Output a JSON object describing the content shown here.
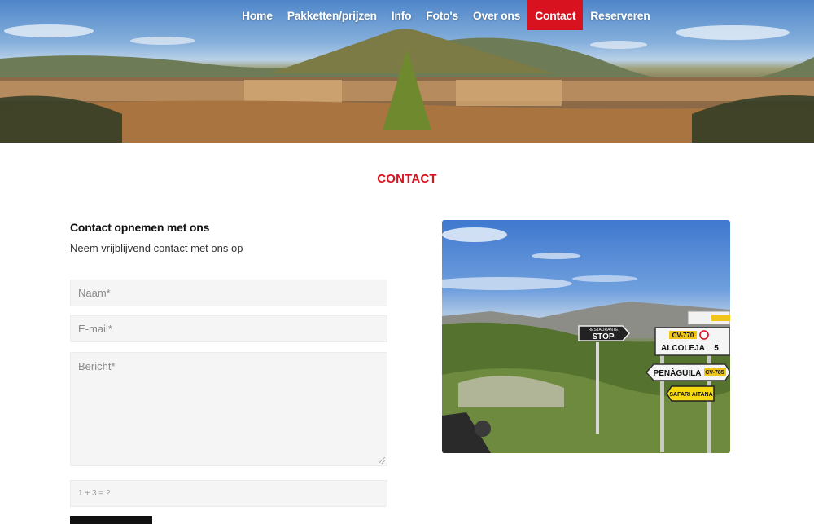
{
  "nav": {
    "items": [
      {
        "label": "Home",
        "active": false
      },
      {
        "label": "Pakketten/prijzen",
        "active": false
      },
      {
        "label": "Info",
        "active": false
      },
      {
        "label": "Foto's",
        "active": false
      },
      {
        "label": "Over ons",
        "active": false
      },
      {
        "label": "Contact",
        "active": true
      },
      {
        "label": "Reserveren",
        "active": false
      }
    ],
    "active_color": "#d9121f"
  },
  "page": {
    "title": "CONTACT",
    "accent_color": "#d9121f"
  },
  "contact": {
    "heading": "Contact opnemen met ons",
    "subtext": "Neem vrijblijvend contact met ons op"
  },
  "form": {
    "name_placeholder": "Naam*",
    "email_placeholder": "E-mail*",
    "message_placeholder": "Bericht*",
    "captcha_placeholder": "1 + 3 = ?"
  },
  "photo": {
    "signs": {
      "restaurant": "RESTAURANTE",
      "stop": "STOP",
      "road1": "CV-770",
      "town1": "ALCOLEJA",
      "town1_distance": "5",
      "town2": "PENÀGUILA",
      "road2": "CV-785",
      "safari": "SAFARI AITANA"
    }
  }
}
